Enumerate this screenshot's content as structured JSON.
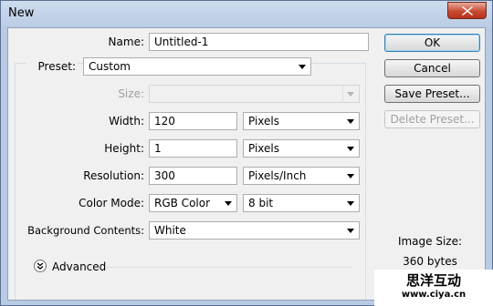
{
  "window": {
    "title": "New"
  },
  "form": {
    "name_label": "Name:",
    "name_value": "Untitled-1",
    "preset_label": "Preset:",
    "preset_value": "Custom",
    "size_label": "Size:",
    "size_value": "",
    "width_label": "Width:",
    "width_value": "120",
    "width_unit": "Pixels",
    "height_label": "Height:",
    "height_value": "1",
    "height_unit": "Pixels",
    "resolution_label": "Resolution:",
    "resolution_value": "300",
    "resolution_unit": "Pixels/Inch",
    "color_mode_label": "Color Mode:",
    "color_mode_value": "RGB Color",
    "bit_depth_value": "8 bit",
    "background_label": "Background Contents:",
    "background_value": "White",
    "advanced_label": "Advanced"
  },
  "buttons": {
    "ok": "OK",
    "cancel": "Cancel",
    "save_preset": "Save Preset...",
    "delete_preset": "Delete Preset..."
  },
  "info": {
    "image_size_label": "Image Size:",
    "image_size_value": "360 bytes"
  },
  "watermark": {
    "cn_text": "思洋互动",
    "url": "www.ciya.cn"
  },
  "icons": {
    "close": "close-icon",
    "dropdown": "chevron-down-icon",
    "advanced": "double-chevron-down-icon"
  },
  "colors": {
    "titlebar": "#b9cbe4",
    "close_button": "#c74b33",
    "dialog_bg": "#f0f0f0",
    "default_button_border": "#3c7fb1"
  }
}
